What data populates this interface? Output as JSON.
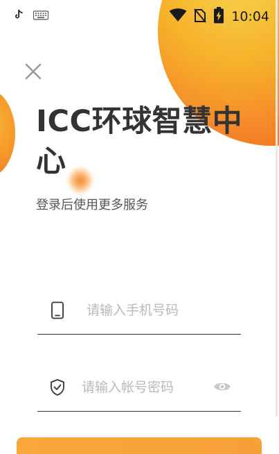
{
  "status_bar": {
    "time": "10:04",
    "icons": [
      "tiktok-icon",
      "keyboard-icon",
      "wifi-icon",
      "no-sim-icon",
      "battery-charging-icon"
    ]
  },
  "header": {
    "close_icon": "close-icon",
    "title": "ICC环球智慧中心",
    "subtitle": "登录后使用更多服务"
  },
  "form": {
    "phone": {
      "placeholder": "请输入手机号码",
      "value": "",
      "icon": "phone-icon"
    },
    "password": {
      "placeholder": "请输入帐号密码",
      "value": "",
      "icon": "shield-check-icon",
      "toggle_icon": "eye-icon"
    }
  },
  "login_button": {
    "label": ""
  },
  "colors": {
    "accent": "#f7a03a",
    "title": "#333333",
    "subtitle": "#555555",
    "placeholder": "#b9b9b9"
  }
}
